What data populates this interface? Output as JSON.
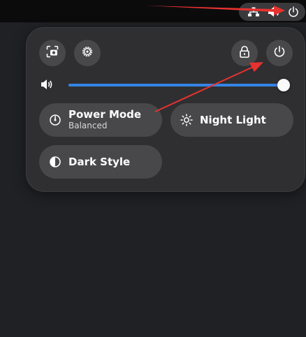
{
  "tray": {
    "icons": [
      "network-wired-icon",
      "volume-icon",
      "power-icon"
    ]
  },
  "quick_settings": {
    "buttons": {
      "screenshot": "screenshot-icon",
      "settings": "settings-gear-icon",
      "lock": "lock-icon",
      "power": "power-icon"
    },
    "volume": {
      "icon": "volume-icon",
      "level_percent": 100
    },
    "toggles": {
      "power_mode": {
        "title": "Power Mode",
        "subtitle": "Balanced"
      },
      "night_light": {
        "title": "Night Light"
      },
      "dark_style": {
        "title": "Dark Style"
      }
    }
  },
  "colors": {
    "accent": "#3584e4",
    "annotation_arrow": "#e8322f",
    "panel_bg": "#2f2f32",
    "button_bg": "#48484b"
  }
}
